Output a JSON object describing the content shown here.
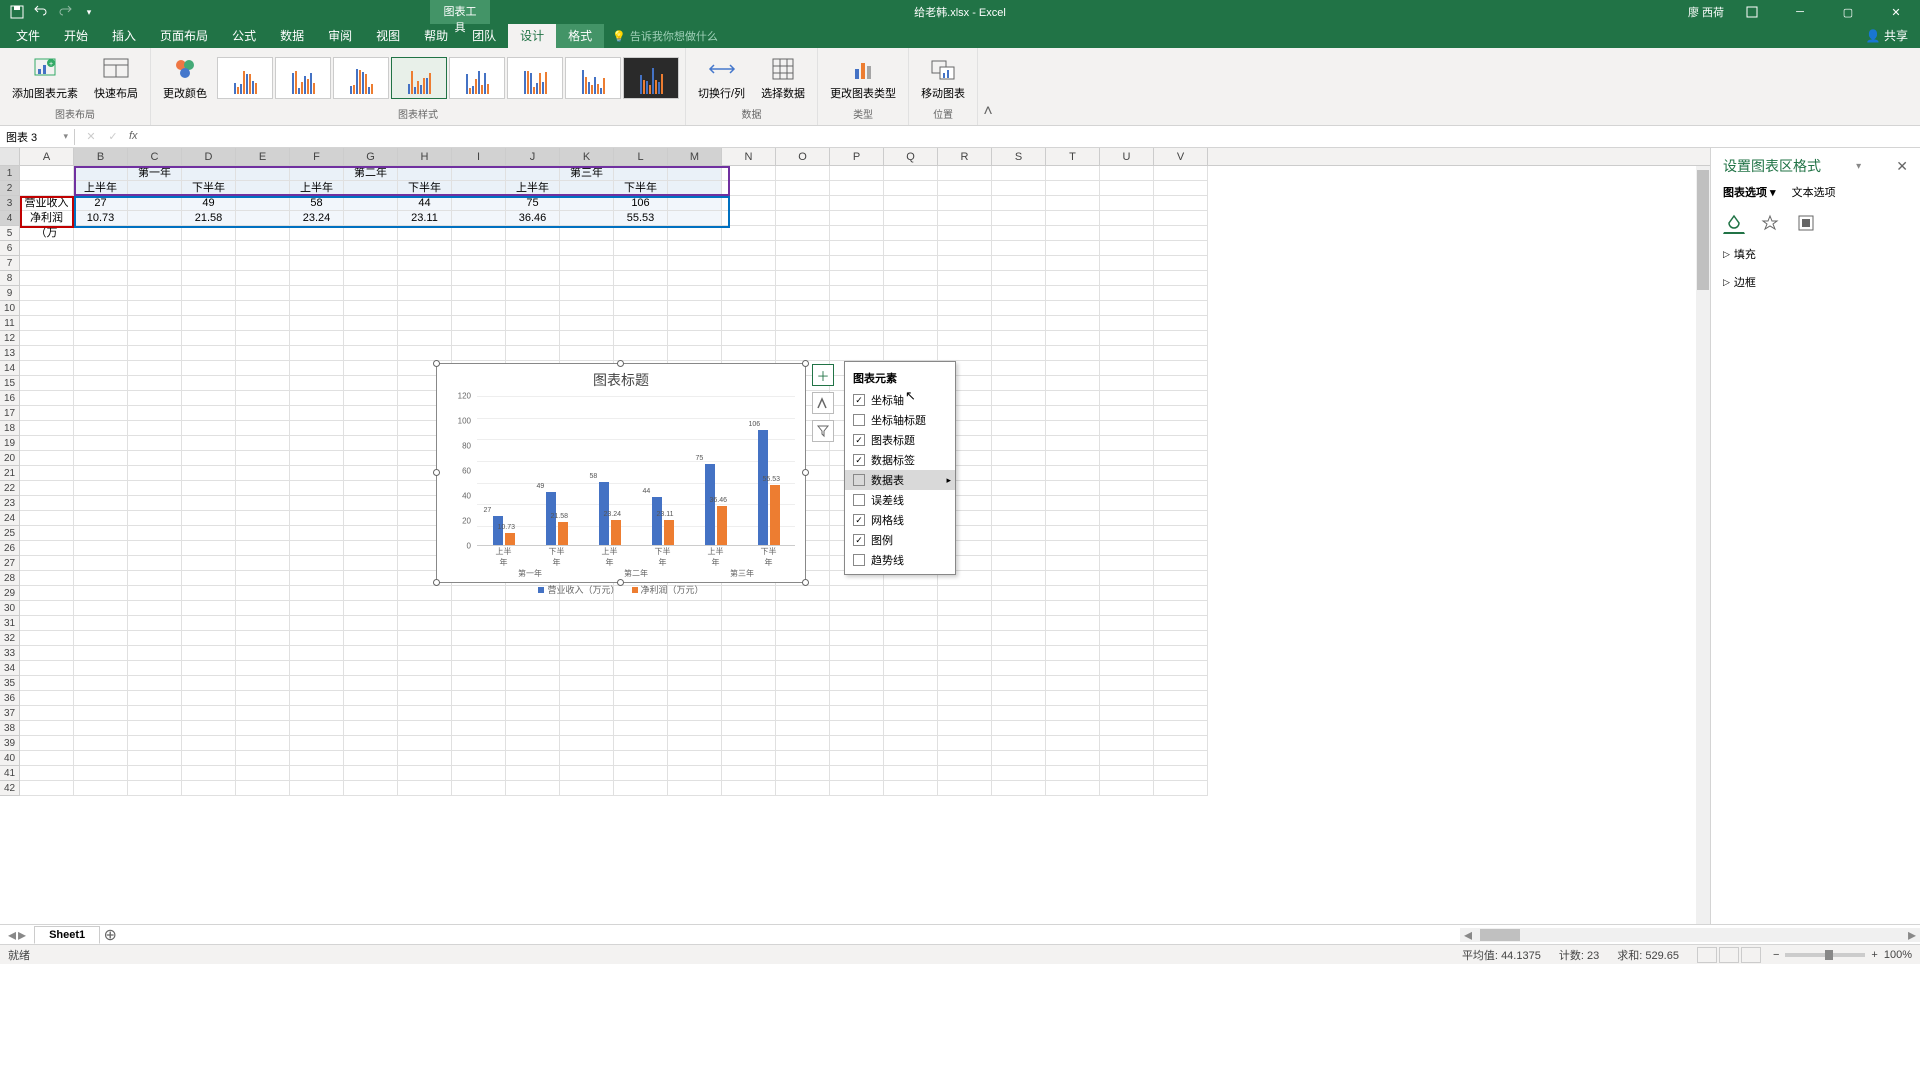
{
  "titlebar": {
    "tool_tab": "图表工具",
    "filename": "给老韩.xlsx - Excel",
    "user": "廖 西荷"
  },
  "tabs": {
    "file": "文件",
    "home": "开始",
    "insert": "插入",
    "layout": "页面布局",
    "formulas": "公式",
    "data": "数据",
    "review": "审阅",
    "view": "视图",
    "help": "帮助",
    "team": "团队",
    "design": "设计",
    "format": "格式",
    "tellme": "告诉我你想做什么",
    "share": "共享"
  },
  "ribbon": {
    "add_element": "添加图表元素",
    "quick_layout": "快速布局",
    "change_colors": "更改颜色",
    "group_layout": "图表布局",
    "group_styles": "图表样式",
    "switch": "切换行/列",
    "select_data": "选择数据",
    "group_data": "数据",
    "change_type": "更改图表类型",
    "group_type": "类型",
    "move_chart": "移动图表",
    "group_location": "位置"
  },
  "namebox": "图表 3",
  "columns": [
    "A",
    "B",
    "C",
    "D",
    "E",
    "F",
    "G",
    "H",
    "I",
    "J",
    "K",
    "L",
    "M",
    "N",
    "O",
    "P",
    "Q",
    "R",
    "S",
    "T",
    "U",
    "V"
  ],
  "table": {
    "years": [
      "第一年",
      "第二年",
      "第三年"
    ],
    "halves": [
      "上半年",
      "下半年",
      "上半年",
      "下半年",
      "上半年",
      "下半年"
    ],
    "row1_label": "营业收入",
    "row2_label": "净利润（万",
    "row1": [
      "27",
      "49",
      "58",
      "44",
      "75",
      "106"
    ],
    "row2": [
      "10.73",
      "21.58",
      "23.24",
      "23.11",
      "36.46",
      "55.53"
    ]
  },
  "chart_data": {
    "type": "bar",
    "title": "图表标题",
    "categories_minor": [
      "上半年",
      "下半年",
      "上半年",
      "下半年",
      "上半年",
      "下半年"
    ],
    "categories_major": [
      "第一年",
      "第二年",
      "第三年"
    ],
    "series": [
      {
        "name": "营业收入（万元）",
        "values": [
          27,
          49,
          58,
          44,
          75,
          106
        ],
        "color": "#4472c4"
      },
      {
        "name": "净利润（万元）",
        "values": [
          10.73,
          21.58,
          23.24,
          23.11,
          36.46,
          55.53
        ],
        "color": "#ed7d31"
      }
    ],
    "ylim": [
      0,
      120
    ],
    "yticks": [
      0,
      20,
      40,
      60,
      80,
      100,
      120
    ]
  },
  "chart_popup": {
    "title": "图表元素",
    "items": [
      {
        "label": "坐标轴",
        "checked": true
      },
      {
        "label": "坐标轴标题",
        "checked": false
      },
      {
        "label": "图表标题",
        "checked": true
      },
      {
        "label": "数据标签",
        "checked": true
      },
      {
        "label": "数据表",
        "checked": false,
        "hover": true,
        "arrow": true
      },
      {
        "label": "误差线",
        "checked": false
      },
      {
        "label": "网格线",
        "checked": true
      },
      {
        "label": "图例",
        "checked": true
      },
      {
        "label": "趋势线",
        "checked": false
      }
    ]
  },
  "format_pane": {
    "title": "设置图表区格式",
    "tab1": "图表选项",
    "tab2": "文本选项",
    "fill": "填充",
    "border": "边框"
  },
  "sheet": {
    "name": "Sheet1"
  },
  "status": {
    "ready": "就绪",
    "avg_label": "平均值:",
    "avg": "44.1375",
    "count_label": "计数:",
    "count": "23",
    "sum_label": "求和:",
    "sum": "529.65",
    "zoom": "100%"
  }
}
